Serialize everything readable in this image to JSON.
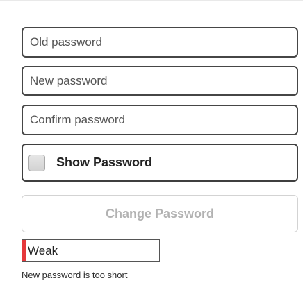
{
  "form": {
    "old_password": {
      "value": "",
      "placeholder": "Old password"
    },
    "new_password": {
      "value": "",
      "placeholder": "New password"
    },
    "confirm_password": {
      "value": "",
      "placeholder": "Confirm password"
    },
    "show_password": {
      "label": "Show Password",
      "checked": false
    },
    "change_button": {
      "label": "Change Password",
      "enabled": false
    }
  },
  "strength": {
    "label": "Weak",
    "level": 0.03,
    "color": "#e5383b"
  },
  "message": "New password is too short",
  "colors": {
    "field_border": "#464646",
    "disabled_text": "#b2b2b2",
    "weak": "#e5383b"
  }
}
